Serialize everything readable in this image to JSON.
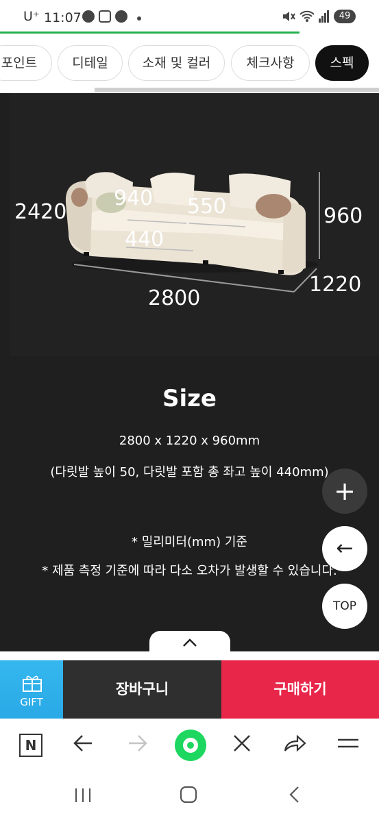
{
  "status_bar": {
    "carrier": "U⁺",
    "time": "11:07",
    "battery": "49"
  },
  "tabs": [
    {
      "label": "포인트"
    },
    {
      "label": "디테일"
    },
    {
      "label": "소재 및 컬러"
    },
    {
      "label": "체크사항"
    },
    {
      "label": "스펙"
    }
  ],
  "product_image": {
    "dimensions": {
      "d2420": "2420",
      "d940": "940",
      "d550": "550",
      "d440": "440",
      "d960": "960",
      "d1220": "1220",
      "d2800": "2800"
    }
  },
  "spec": {
    "title": "Size",
    "size_line": "2800 x 1220 x 960mm",
    "detail_line": "(다릿발 높이 50, 다릿발 포함 총 좌고 높이 440mm)",
    "note1": "* 밀리미터(mm) 기준",
    "note2": "* 제품 측정 기준에 따라 다소 오차가 발생할 수 있습니다."
  },
  "floating": {
    "plus": "+",
    "back": "←",
    "top": "TOP",
    "collapse": "^"
  },
  "purchase_bar": {
    "gift_label": "GIFT",
    "cart_label": "장바구니",
    "buy_label": "구매하기"
  },
  "browser_toolbar": {
    "n_label": "N"
  },
  "colors": {
    "accent_green": "#1ed760",
    "buy_red": "#e8264a",
    "gift_blue": "#35b7ee",
    "content_bg": "#1f1f1f"
  }
}
